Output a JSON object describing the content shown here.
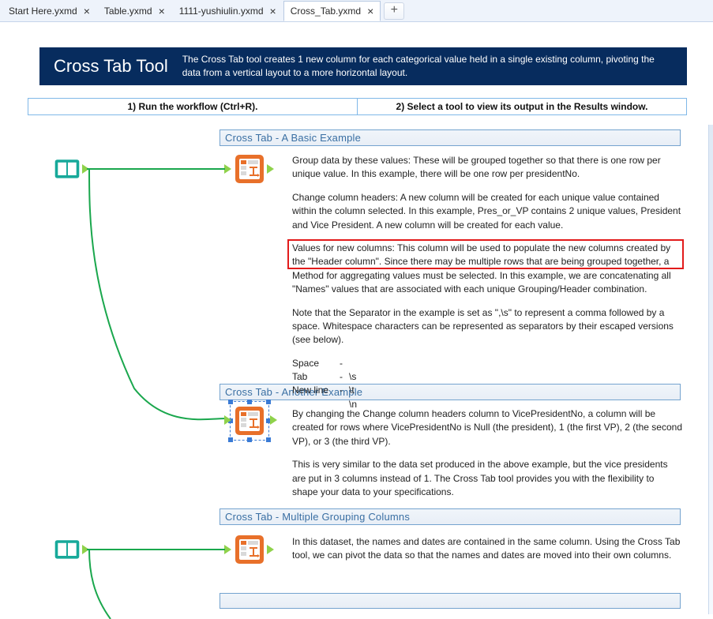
{
  "tabs": [
    {
      "label": "Start Here.yxmd",
      "active": false
    },
    {
      "label": "Table.yxmd",
      "active": false
    },
    {
      "label": "1111-yushiulin.yxmd",
      "active": false
    },
    {
      "label": "Cross_Tab.yxmd",
      "active": true
    }
  ],
  "header": {
    "title": "Cross Tab Tool",
    "description": "The Cross Tab tool creates 1 new column for each categorical value held in a single existing column, pivoting the data from a vertical layout to a more horizontal layout."
  },
  "instructions": {
    "step1": "1) Run the workflow (Ctrl+R).",
    "step2": "2) Select a tool to view its output in the Results window."
  },
  "sections": {
    "s1": "Cross Tab - A Basic Example",
    "s2": "Cross Tab - Another Example",
    "s3": "Cross Tab - Multiple Grouping Columns",
    "s4": ""
  },
  "body": {
    "s1_p1": "Group data by these values: These will be grouped together so that there is one row per unique value. In this example, there will be one row per presidentNo.",
    "s1_p2": "Change column headers: A new column will be created for each unique value contained within the column selected. In this example, Pres_or_VP contains 2 unique values, President and Vice President. A new column will be created for each value.",
    "s1_p3": "Values for new columns: This column will be used to populate the new columns created by the \"Header column\". Since there may be multiple rows that are being grouped together, a Method for aggregating values must be selected. In this example, we are concatenating all \"Names\" values that are associated with each unique Grouping/Header combination.",
    "s1_p4": "Note that the Separator in the example is set as \",\\s\" to represent a comma followed by a space. Whitespace characters can be represented as separators by their escaped versions (see below).",
    "sep": [
      {
        "k": "Space",
        "d": "-",
        "v": ""
      },
      {
        "k": "Tab",
        "d": "-",
        "v": "\\s"
      },
      {
        "k": "New line",
        "d": "-",
        "v": "\\t"
      },
      {
        "k": "",
        "d": "",
        "v": "\\n"
      }
    ],
    "s2_p1": "By changing the Change column headers column to VicePresidentNo, a column will be created for rows where VicePresidentNo is Null (the president), 1 (the first VP), 2 (the second VP), or 3 (the third VP).",
    "s2_p2": "This is very similar to the data set produced in the above example, but the vice presidents are put in 3 columns instead of 1. The Cross Tab tool provides you with the flexibility to shape your data to your specifications.",
    "s3_p1": "In this dataset, the names and dates are contained in the same column. Using the Cross Tab tool, we can pivot the data so that the names and dates are moved into their own columns."
  },
  "icons": {
    "book": "book-icon",
    "crosstab": "crosstab-tool-icon"
  }
}
